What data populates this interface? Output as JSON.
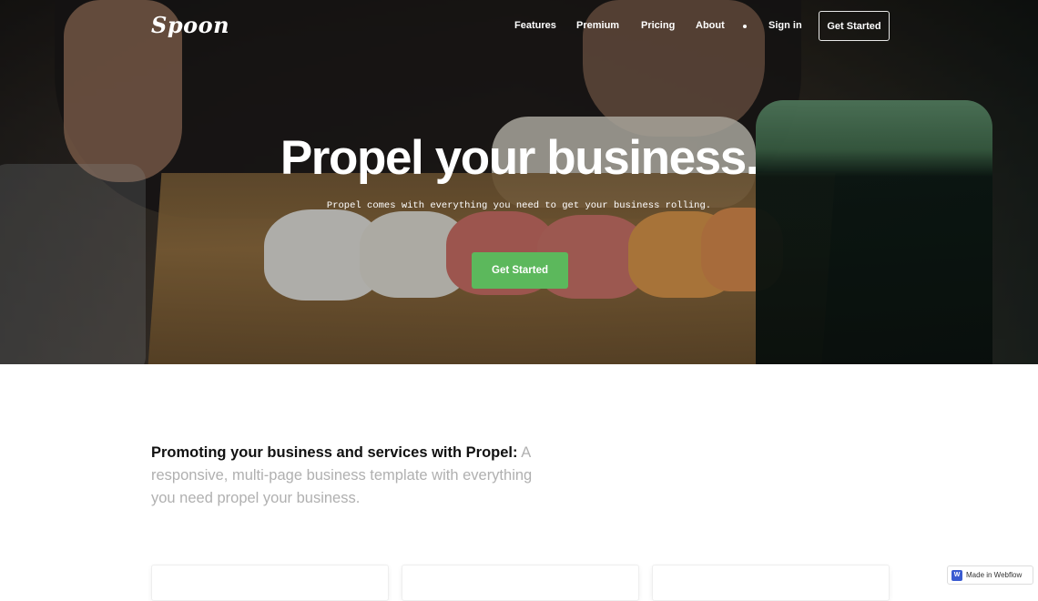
{
  "nav": {
    "logo": "Spoon",
    "links": [
      "Features",
      "Premium",
      "Pricing",
      "About"
    ],
    "sign_in": "Sign in",
    "cta": "Get Started"
  },
  "hero": {
    "title": "Propel your business.",
    "subtitle": "Propel comes with everything you need to get your business rolling.",
    "button": "Get Started"
  },
  "intro": {
    "bold": "Promoting your business and services with Propel:",
    "text": " A responsive, multi-page business template with everything you need propel your business."
  },
  "badge": {
    "icon_letter": "W",
    "label": "Made in Webflow"
  },
  "colors": {
    "accent_green": "#5cb85c",
    "webflow_blue": "#3a5bd1"
  }
}
